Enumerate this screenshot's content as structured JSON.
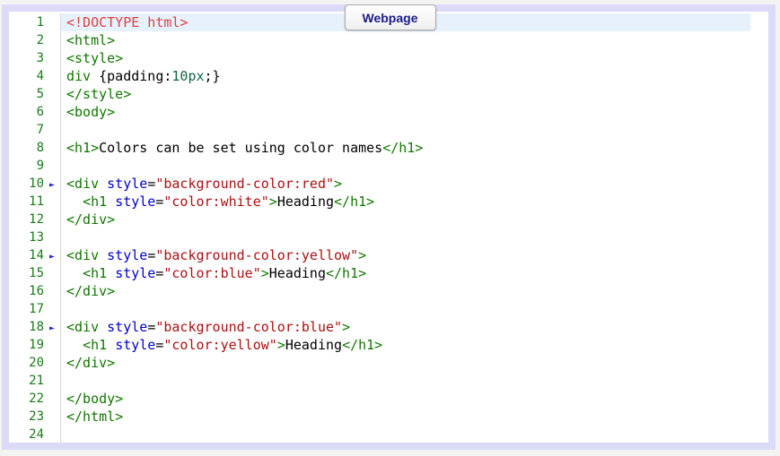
{
  "window": {
    "tab": {
      "label": "Webpage"
    }
  },
  "editor": {
    "active_line": 1,
    "fold_marker_lines": [
      10,
      14,
      18
    ],
    "fold_marker_icon": "►",
    "line_count": 24,
    "lines": [
      {
        "tokens": [
          [
            "doctype",
            "<!DOCTYPE html>"
          ]
        ]
      },
      {
        "tokens": [
          [
            "tag",
            "<html>"
          ]
        ]
      },
      {
        "tokens": [
          [
            "tag",
            "<style>"
          ]
        ]
      },
      {
        "tokens": [
          [
            "tag",
            "div"
          ],
          [
            "plain",
            " {padding:"
          ],
          [
            "number",
            "10px"
          ],
          [
            "plain",
            ";}"
          ]
        ]
      },
      {
        "tokens": [
          [
            "tag",
            "</style>"
          ]
        ]
      },
      {
        "tokens": [
          [
            "tag",
            "<body>"
          ]
        ]
      },
      {
        "tokens": []
      },
      {
        "tokens": [
          [
            "tag",
            "<h1>"
          ],
          [
            "plain",
            "Colors can be set using color names"
          ],
          [
            "tag",
            "</h1>"
          ]
        ]
      },
      {
        "tokens": []
      },
      {
        "tokens": [
          [
            "tag",
            "<div "
          ],
          [
            "attribute",
            "style"
          ],
          [
            "plain",
            "="
          ],
          [
            "string",
            "\"background-color:red\""
          ],
          [
            "tag",
            ">"
          ]
        ]
      },
      {
        "tokens": [
          [
            "plain",
            "  "
          ],
          [
            "tag",
            "<h1 "
          ],
          [
            "attribute",
            "style"
          ],
          [
            "plain",
            "="
          ],
          [
            "string",
            "\"color:white\""
          ],
          [
            "tag",
            ">"
          ],
          [
            "plain",
            "Heading"
          ],
          [
            "tag",
            "</h1>"
          ]
        ]
      },
      {
        "tokens": [
          [
            "tag",
            "</div>"
          ]
        ]
      },
      {
        "tokens": []
      },
      {
        "tokens": [
          [
            "tag",
            "<div "
          ],
          [
            "attribute",
            "style"
          ],
          [
            "plain",
            "="
          ],
          [
            "string",
            "\"background-color:yellow\""
          ],
          [
            "tag",
            ">"
          ]
        ]
      },
      {
        "tokens": [
          [
            "plain",
            "  "
          ],
          [
            "tag",
            "<h1 "
          ],
          [
            "attribute",
            "style"
          ],
          [
            "plain",
            "="
          ],
          [
            "string",
            "\"color:blue\""
          ],
          [
            "tag",
            ">"
          ],
          [
            "plain",
            "Heading"
          ],
          [
            "tag",
            "</h1>"
          ]
        ]
      },
      {
        "tokens": [
          [
            "tag",
            "</div>"
          ]
        ]
      },
      {
        "tokens": []
      },
      {
        "tokens": [
          [
            "tag",
            "<div "
          ],
          [
            "attribute",
            "style"
          ],
          [
            "plain",
            "="
          ],
          [
            "string",
            "\"background-color:blue\""
          ],
          [
            "tag",
            ">"
          ]
        ]
      },
      {
        "tokens": [
          [
            "plain",
            "  "
          ],
          [
            "tag",
            "<h1 "
          ],
          [
            "attribute",
            "style"
          ],
          [
            "plain",
            "="
          ],
          [
            "string",
            "\"color:yellow\""
          ],
          [
            "tag",
            ">"
          ],
          [
            "plain",
            "Heading"
          ],
          [
            "tag",
            "</h1>"
          ]
        ]
      },
      {
        "tokens": [
          [
            "tag",
            "</div>"
          ]
        ]
      },
      {
        "tokens": []
      },
      {
        "tokens": [
          [
            "tag",
            "</body>"
          ]
        ]
      },
      {
        "tokens": [
          [
            "tag",
            "</html>"
          ]
        ]
      },
      {
        "tokens": []
      }
    ]
  },
  "colors": {
    "page_background": "#f3f3f2",
    "frame_border": "#dbdbf7",
    "editor_background": "#ffffff",
    "active_line_highlight": "#e7f1fc",
    "gutter_separator": "#d9d9d9",
    "line_number": "#1a7a1a",
    "fold_marker": "#2222cc",
    "tab_text": "#1b1b8c",
    "tab_border": "#a9a9a9",
    "token": {
      "doctype": "#dd4040",
      "tag": "#117700",
      "attribute": "#0000cc",
      "string": "#aa1111",
      "number": "#116644",
      "plain": "#000000"
    }
  }
}
